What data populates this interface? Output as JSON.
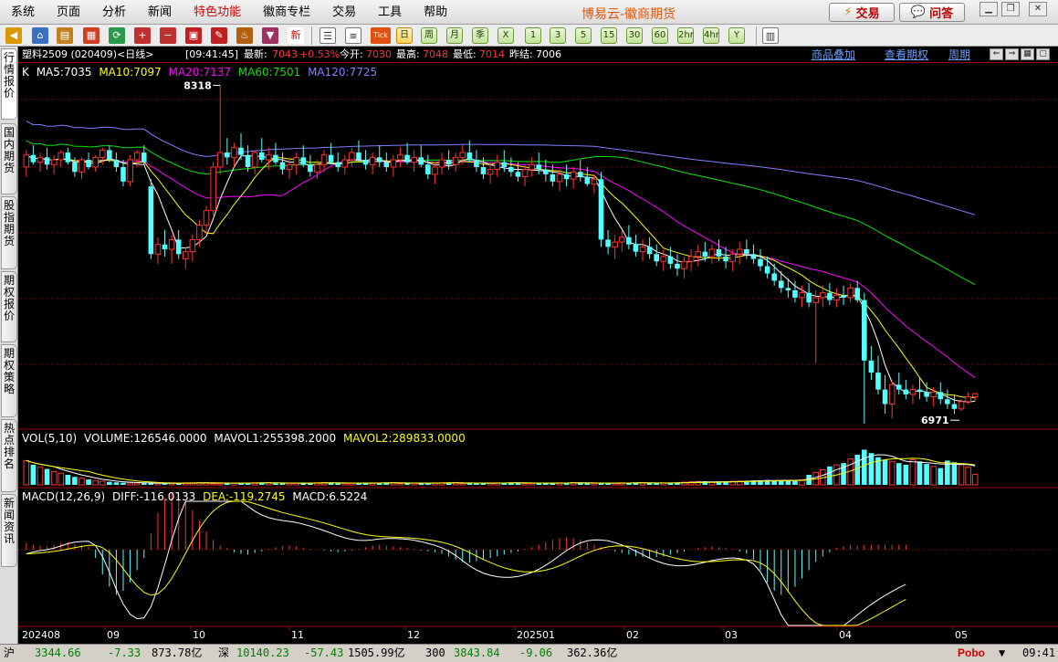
{
  "menu": {
    "items": [
      "系统",
      "页面",
      "分析",
      "新闻",
      "特色功能",
      "徽商专栏",
      "交易",
      "工具",
      "帮助"
    ],
    "special_index": 4
  },
  "app_title": "博易云-徽商期货",
  "buttons": {
    "trade": "交易",
    "ask": "问答"
  },
  "toolbar": {
    "periods": [
      "日",
      "周",
      "月",
      "季",
      "X",
      "1",
      "3",
      "5",
      "15",
      "30",
      "60",
      "2hr",
      "4hr",
      "Y"
    ],
    "active_period": "日",
    "tick_label": "Tick",
    "new_label": "新"
  },
  "left_tabs": [
    "行情报价",
    "国内期货",
    "股指期货",
    "期权报价",
    "期权策略",
    "热点排名",
    "新闻资讯"
  ],
  "info": {
    "contract": "塑料2509 (020409)<日线>",
    "time": "[09:41:45]",
    "latest_label": "最新:",
    "latest_value": "7043",
    "change_pct": "+0.53%",
    "open_label": "今开:",
    "open_value": "7030",
    "high_label": "最高:",
    "high_value": "7048",
    "low_label": "最低:",
    "low_value": "7014",
    "prev_label": "昨结:",
    "prev_value": "7006",
    "link_overlay": "商品叠加",
    "link_options": "查看期权",
    "link_period": "周期"
  },
  "ma_legend": {
    "k": "K",
    "ma5": "MA5:7035",
    "ma10": "MA10:7097",
    "ma20": "MA20:7137",
    "ma60": "MA60:7501",
    "ma120": "MA120:7725"
  },
  "vol_legend": {
    "title": "VOL(5,10)",
    "volume": "VOLUME:126546.0000",
    "mavol1": "MAVOL1:255398.2000",
    "mavol2": "MAVOL2:289833.0000"
  },
  "macd_legend": {
    "title": "MACD(12,26,9)",
    "diff": "DIFF:-116.0133",
    "dea": "DEA:-119.2745",
    "macd": "MACD:6.5224"
  },
  "annotations": {
    "high": "8318",
    "low": "6971"
  },
  "colors": {
    "up": "#ff3232",
    "down": "#54ffff",
    "ma5": "#ffffff",
    "ma10": "#ffff00",
    "ma20": "#ff00ff",
    "ma60": "#00e600",
    "ma120": "#7f7fff",
    "grid": "#8b0000"
  },
  "status": {
    "sh_label": "沪",
    "sh_value": "3344.66",
    "sh_change": "-7.33",
    "sh_amount": "873.78亿",
    "sz_label": "深",
    "sz_value": "10140.23",
    "sz_change": "-57.43",
    "sz_amount": "1505.99亿",
    "i300_label": "300",
    "i300_value": "3843.84",
    "i300_change": "-9.06",
    "i300_amount": "362.36亿",
    "brand": "Pobo",
    "clock": "09:41"
  },
  "chart_data": {
    "type": "candlestick",
    "x_tick_labels": [
      "202408",
      "09",
      "10",
      "11",
      "12",
      "202501",
      "02",
      "03",
      "04",
      "05"
    ],
    "price_marks": {
      "high": 8318,
      "low": 6971
    },
    "ma_last": {
      "ma5": 7035,
      "ma10": 7097,
      "ma20": 7137,
      "ma60": 7501,
      "ma120": 7725
    },
    "candles": [
      [
        7980,
        8050,
        7940,
        8030
      ],
      [
        8030,
        8070,
        7990,
        8000
      ],
      [
        8000,
        8040,
        7960,
        8020
      ],
      [
        8020,
        8060,
        7970,
        7990
      ],
      [
        7990,
        8030,
        7950,
        8010
      ],
      [
        8010,
        8050,
        7980,
        8040
      ],
      [
        8040,
        8060,
        7990,
        8000
      ],
      [
        8000,
        8020,
        7940,
        7960
      ],
      [
        7960,
        8020,
        7930,
        8010
      ],
      [
        8010,
        8040,
        7970,
        7980
      ],
      [
        7980,
        8030,
        7960,
        8020
      ],
      [
        8020,
        8060,
        7990,
        8050
      ],
      [
        8050,
        8070,
        8000,
        8010
      ],
      [
        8010,
        8040,
        7960,
        7980
      ],
      [
        7980,
        8010,
        7900,
        7920
      ],
      [
        7920,
        8030,
        7900,
        8010
      ],
      [
        8010,
        8050,
        7980,
        8040
      ],
      [
        8040,
        8070,
        7990,
        8000
      ],
      [
        7900,
        7930,
        7600,
        7620
      ],
      [
        7620,
        7690,
        7580,
        7660
      ],
      [
        7660,
        7720,
        7610,
        7640
      ],
      [
        7640,
        7700,
        7580,
        7680
      ],
      [
        7680,
        7720,
        7600,
        7620
      ],
      [
        7600,
        7650,
        7560,
        7630
      ],
      [
        7630,
        7700,
        7590,
        7680
      ],
      [
        7680,
        7760,
        7650,
        7740
      ],
      [
        7740,
        7820,
        7700,
        7800
      ],
      [
        7800,
        8000,
        7780,
        7980
      ],
      [
        7980,
        8318,
        7950,
        8040
      ],
      [
        8040,
        8100,
        7990,
        8020
      ],
      [
        8020,
        8080,
        7980,
        8060
      ],
      [
        8060,
        8120,
        8010,
        8030
      ],
      [
        8030,
        8070,
        7960,
        7980
      ],
      [
        7980,
        8050,
        7950,
        8040
      ],
      [
        8040,
        8100,
        8000,
        8010
      ],
      [
        8010,
        8060,
        7970,
        8030
      ],
      [
        8030,
        8080,
        7990,
        8000
      ],
      [
        8000,
        8040,
        7950,
        7970
      ],
      [
        7970,
        8020,
        7930,
        7990
      ],
      [
        7990,
        8040,
        7950,
        8020
      ],
      [
        8020,
        8070,
        7980,
        7990
      ],
      [
        7990,
        8030,
        7940,
        7960
      ],
      [
        7960,
        8010,
        7930,
        7990
      ],
      [
        7990,
        8050,
        7960,
        8030
      ],
      [
        8030,
        8080,
        7990,
        8000
      ],
      [
        8000,
        8040,
        7960,
        7980
      ],
      [
        7980,
        8030,
        7950,
        8010
      ],
      [
        8010,
        8060,
        7980,
        8040
      ],
      [
        8040,
        8090,
        8000,
        8010
      ],
      [
        8010,
        8050,
        7970,
        7990
      ],
      [
        7990,
        8040,
        7950,
        8020
      ],
      [
        8020,
        8070,
        7980,
        8000
      ],
      [
        8000,
        8040,
        7960,
        7980
      ],
      [
        7980,
        8030,
        7940,
        8010
      ],
      [
        8010,
        8060,
        7980,
        8030
      ],
      [
        8030,
        8080,
        7990,
        8000
      ],
      [
        8000,
        8050,
        7960,
        8020
      ],
      [
        8020,
        8070,
        7980,
        7990
      ],
      [
        7990,
        8030,
        7930,
        7950
      ],
      [
        7950,
        8000,
        7910,
        7980
      ],
      [
        7980,
        8040,
        7950,
        8010
      ],
      [
        8010,
        8050,
        7970,
        7990
      ],
      [
        7990,
        8040,
        7960,
        8020
      ],
      [
        8020,
        8070,
        7990,
        8040
      ],
      [
        8040,
        8090,
        8000,
        8010
      ],
      [
        8010,
        8050,
        7960,
        7980
      ],
      [
        7980,
        8020,
        7930,
        7950
      ],
      [
        7950,
        8000,
        7910,
        7970
      ],
      [
        7970,
        8030,
        7940,
        8000
      ],
      [
        8000,
        8050,
        7960,
        7980
      ],
      [
        7980,
        8020,
        7940,
        7960
      ],
      [
        7960,
        8000,
        7920,
        7940
      ],
      [
        7940,
        7990,
        7900,
        7970
      ],
      [
        7970,
        8020,
        7940,
        7990
      ],
      [
        7990,
        8040,
        7950,
        7970
      ],
      [
        7970,
        8010,
        7920,
        7950
      ],
      [
        7950,
        7990,
        7900,
        7920
      ],
      [
        7920,
        7970,
        7880,
        7950
      ],
      [
        7950,
        7990,
        7900,
        7930
      ],
      [
        7930,
        7980,
        7890,
        7960
      ],
      [
        7960,
        8010,
        7920,
        7940
      ],
      [
        7940,
        7980,
        7900,
        7910
      ],
      [
        7910,
        7950,
        7870,
        7930
      ],
      [
        7930,
        7960,
        7650,
        7680
      ],
      [
        7680,
        7720,
        7620,
        7650
      ],
      [
        7650,
        7700,
        7600,
        7670
      ],
      [
        7670,
        7720,
        7630,
        7690
      ],
      [
        7690,
        7740,
        7640,
        7660
      ],
      [
        7660,
        7700,
        7610,
        7630
      ],
      [
        7630,
        7680,
        7590,
        7650
      ],
      [
        7650,
        7690,
        7600,
        7620
      ],
      [
        7620,
        7660,
        7570,
        7590
      ],
      [
        7590,
        7640,
        7550,
        7610
      ],
      [
        7610,
        7650,
        7560,
        7580
      ],
      [
        7580,
        7620,
        7530,
        7560
      ],
      [
        7560,
        7610,
        7520,
        7590
      ],
      [
        7590,
        7640,
        7550,
        7610
      ],
      [
        7610,
        7660,
        7570,
        7630
      ],
      [
        7630,
        7670,
        7590,
        7610
      ],
      [
        7610,
        7660,
        7580,
        7640
      ],
      [
        7640,
        7680,
        7590,
        7610
      ],
      [
        7610,
        7650,
        7560,
        7590
      ],
      [
        7590,
        7640,
        7550,
        7620
      ],
      [
        7620,
        7670,
        7580,
        7640
      ],
      [
        7640,
        7680,
        7600,
        7620
      ],
      [
        7620,
        7660,
        7580,
        7600
      ],
      [
        7600,
        7640,
        7550,
        7570
      ],
      [
        7570,
        7610,
        7520,
        7540
      ],
      [
        7540,
        7580,
        7490,
        7510
      ],
      [
        7510,
        7550,
        7460,
        7480
      ],
      [
        7480,
        7520,
        7440,
        7470
      ],
      [
        7470,
        7510,
        7420,
        7440
      ],
      [
        7440,
        7490,
        7400,
        7460
      ],
      [
        7460,
        7500,
        7400,
        7420
      ],
      [
        7420,
        7470,
        7170,
        7440
      ],
      [
        7440,
        7490,
        7400,
        7460
      ],
      [
        7460,
        7500,
        7410,
        7430
      ],
      [
        7430,
        7480,
        7400,
        7450
      ],
      [
        7450,
        7490,
        7410,
        7440
      ],
      [
        7440,
        7500,
        7420,
        7480
      ],
      [
        7480,
        7510,
        7420,
        7430
      ],
      [
        7430,
        7460,
        6920,
        7180
      ],
      [
        7180,
        7240,
        7100,
        7130
      ],
      [
        7130,
        7200,
        7040,
        7060
      ],
      [
        7060,
        7120,
        6960,
        7000
      ],
      [
        7000,
        7100,
        6940,
        7080
      ],
      [
        7080,
        7130,
        7040,
        7060
      ],
      [
        7060,
        7100,
        7020,
        7040
      ],
      [
        7040,
        7080,
        7000,
        7060
      ],
      [
        7060,
        7110,
        7020,
        7050
      ],
      [
        7050,
        7090,
        7010,
        7030
      ],
      [
        7030,
        7070,
        6990,
        7050
      ],
      [
        7050,
        7090,
        7000,
        7020
      ],
      [
        7020,
        7060,
        6980,
        7000
      ],
      [
        7000,
        7040,
        6960,
        6980
      ],
      [
        6980,
        7020,
        6971,
        7010
      ],
      [
        7010,
        7048,
        7000,
        7030
      ],
      [
        7030,
        7048,
        7014,
        7043
      ]
    ],
    "volume": [
      290000,
      240000,
      210000,
      190000,
      160000,
      140000,
      120000,
      95000,
      80000,
      65000,
      52000,
      43000,
      36000,
      30000,
      26000,
      23000,
      21000,
      20000,
      19000,
      18000
    ],
    "volume_recent": [
      120000,
      150000,
      180000,
      220000,
      240000,
      260000,
      310000,
      360000,
      420000,
      380000,
      330000,
      300000,
      280000,
      260000,
      240000,
      300000,
      280000,
      250000,
      220000,
      200000,
      290000,
      270000,
      240000,
      210000,
      126546
    ],
    "macd_hist": [
      8,
      6,
      5,
      4,
      6,
      8,
      9,
      7,
      5,
      4,
      -10,
      -30,
      -45,
      -55,
      -50,
      -40,
      -25,
      -10,
      20,
      45,
      62,
      70,
      68,
      60,
      48,
      35,
      22,
      12,
      5,
      2,
      -3,
      -5,
      -6,
      -4,
      -2,
      1,
      3,
      4,
      5,
      4,
      2,
      1,
      0,
      -1,
      -2,
      -3,
      -2,
      -1,
      1,
      3,
      5,
      6,
      5,
      4,
      3,
      2,
      1,
      -1,
      -2,
      -3,
      -5,
      -8,
      -12,
      -15,
      -16,
      -14,
      -12,
      -10,
      -8,
      -6,
      -4,
      -2,
      1,
      3,
      6,
      9,
      12,
      14,
      15,
      14,
      12,
      9,
      6,
      3,
      1,
      -2,
      -4,
      -6,
      -8,
      -9,
      -10,
      -9,
      -8,
      -6,
      -4,
      -2,
      0,
      2,
      3,
      4,
      3,
      2,
      1,
      -2,
      -5,
      -12,
      -25,
      -40,
      -50,
      -55,
      -52,
      -45,
      -35,
      -25,
      -15,
      -8,
      -3,
      2,
      4,
      6,
      5,
      6,
      6,
      6,
      6,
      6,
      6,
      6
    ]
  }
}
